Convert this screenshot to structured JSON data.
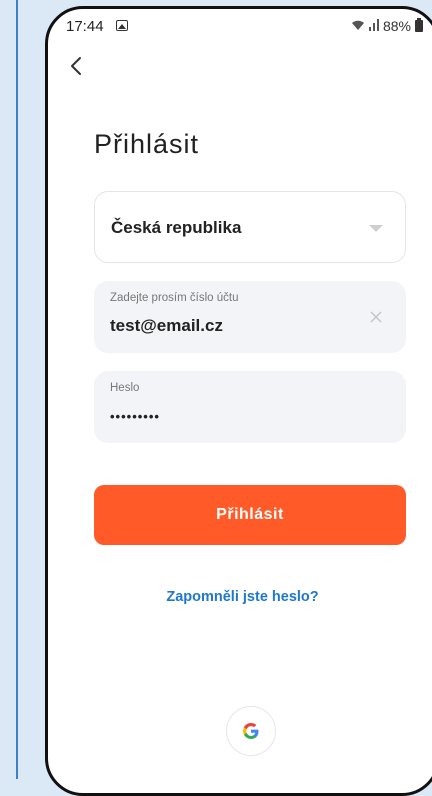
{
  "status_bar": {
    "time": "17:44",
    "battery": "88%",
    "icons": [
      "gallery-icon",
      "wifi-icon",
      "signal-icon",
      "battery-icon"
    ]
  },
  "header": {
    "back_icon": "chevron-left-icon"
  },
  "title": "Přihlásit",
  "country": {
    "selected": "Česká republika",
    "dropdown_icon": "caret-down-icon"
  },
  "account_field": {
    "label": "Zadejte prosím číslo účtu",
    "value": "test@email.cz",
    "clear_icon": "close-icon"
  },
  "password_field": {
    "label": "Heslo",
    "value": "•••••••••"
  },
  "login_button": {
    "label": "Přihlásit"
  },
  "forgot_password": {
    "label": "Zapomněli jste heslo?"
  },
  "social_login": {
    "icon": "google-icon"
  },
  "colors": {
    "accent": "#ff5a28",
    "link": "#1e78d0",
    "field_bg": "#f3f4f7",
    "background": "#dbe9f7"
  }
}
